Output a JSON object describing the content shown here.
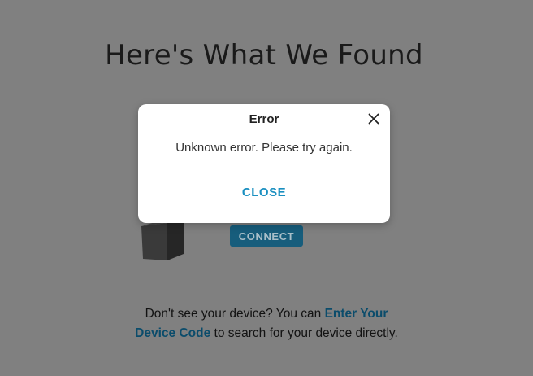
{
  "page": {
    "title": "Here's What We Found",
    "connect_label": "CONNECT",
    "help": {
      "prefix": "Don't see your device? You can ",
      "link": "Enter Your Device Code",
      "suffix": " to search for your device directly."
    }
  },
  "dialog": {
    "title": "Error",
    "message": "Unknown error. Please try again.",
    "close_label": "CLOSE",
    "close_icon": "close-icon"
  },
  "colors": {
    "overlay_background": "#808080",
    "accent": "#1a8fc0",
    "connect_button": "#175d7c",
    "link": "#0b4c6b"
  }
}
